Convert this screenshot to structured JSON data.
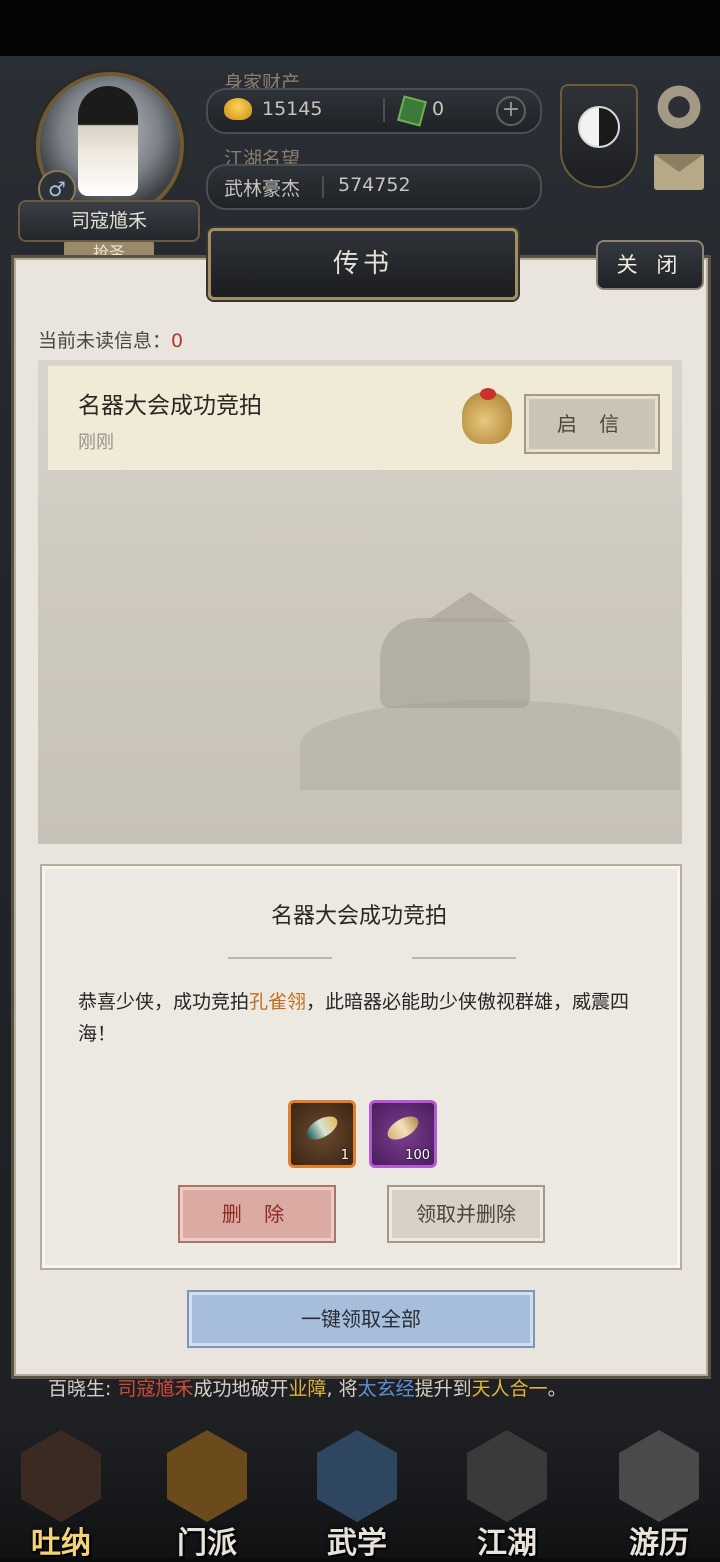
{
  "hud": {
    "player_name": "司寇馗禾",
    "rank_tag": "抢圣",
    "gender_symbol": "♂",
    "wealth_label": "身家财产",
    "gold": "15145",
    "jade": "0",
    "add_symbol": "+",
    "fame_label": "江湖名望",
    "fame_title": "武林豪杰",
    "fame_value": "574752"
  },
  "dialog": {
    "title": "传书",
    "close_label": "关 闭",
    "unread_label": "当前未读信息：",
    "unread_count": "0",
    "mail_item": {
      "title": "名器大会成功竞拍",
      "time": "刚刚",
      "open_label": "启 信"
    },
    "detail": {
      "title": "名器大会成功竞拍",
      "body_prefix": "恭喜少侠，成功竞拍",
      "body_item": "孔雀翎",
      "body_suffix": "，此暗器必能助少侠傲视群雄，威震四海！",
      "rewards": [
        {
          "name": "peacock-feather-item",
          "count": "1",
          "rarity_color": "#e0802c"
        },
        {
          "name": "purple-scroll-item",
          "count": "100",
          "rarity_color": "#b55bd1"
        }
      ],
      "delete_label": "删 除",
      "claim_delete_label": "领取并删除"
    },
    "claim_all_label": "一键领取全部"
  },
  "news": {
    "prefix": "百晓生: ",
    "player": "司寇馗禾",
    "mid1": "成功地破开",
    "karma": "业障",
    "mid2": ", 将",
    "skill": "太玄经",
    "mid3": "提升到",
    "realm": "天人合一",
    "end": "。"
  },
  "bottom_nav": [
    {
      "label": "吐纳"
    },
    {
      "label": "门派"
    },
    {
      "label": "武学"
    },
    {
      "label": "江湖"
    },
    {
      "label": "游历"
    }
  ],
  "colors": {
    "highlight_orange": "#c36c1d",
    "unread_red": "#b23a2a",
    "news_red": "#d04a3a",
    "news_blue": "#5b8fd8",
    "news_yellow": "#e3b43a"
  }
}
